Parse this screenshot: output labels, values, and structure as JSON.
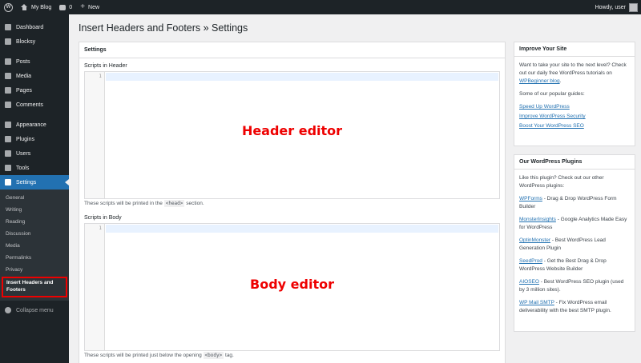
{
  "admin_bar": {
    "site_name": "My Blog",
    "comments_count": "0",
    "new_label": "New",
    "greeting": "Howdy, user"
  },
  "sidebar": {
    "top_items": [
      {
        "label": "Dashboard",
        "icon": "dashboard-icon"
      },
      {
        "label": "Blocksy",
        "icon": "blocksy-icon"
      }
    ],
    "content_items": [
      {
        "label": "Posts",
        "icon": "pin-icon"
      },
      {
        "label": "Media",
        "icon": "media-icon"
      },
      {
        "label": "Pages",
        "icon": "page-icon"
      },
      {
        "label": "Comments",
        "icon": "comment-icon"
      }
    ],
    "admin_items": [
      {
        "label": "Appearance",
        "icon": "brush-icon"
      },
      {
        "label": "Plugins",
        "icon": "plug-icon"
      },
      {
        "label": "Users",
        "icon": "user-icon"
      },
      {
        "label": "Tools",
        "icon": "wrench-icon"
      },
      {
        "label": "Settings",
        "icon": "settings-icon"
      }
    ],
    "submenu": [
      "General",
      "Writing",
      "Reading",
      "Discussion",
      "Media",
      "Permalinks",
      "Privacy"
    ],
    "current_submenu": "Insert Headers and Footers",
    "collapse_label": "Collapse menu"
  },
  "main": {
    "page_title": "Insert Headers and Footers » Settings",
    "box_title": "Settings",
    "header_label": "Scripts in Header",
    "header_line": "1",
    "header_overlay": "Header editor",
    "header_hint_pre": "These scripts will be printed in the",
    "header_hint_code": "<head>",
    "header_hint_post": "section.",
    "body_label": "Scripts in Body",
    "body_line": "1",
    "body_overlay": "Body editor",
    "body_hint_pre": "These scripts will be printed just below the opening",
    "body_hint_code": "<body>",
    "body_hint_post": "tag."
  },
  "improve_widget": {
    "title": "Improve Your Site",
    "intro_pre": "Want to take your site to the next level? Check out our daily free WordPress tutorials on",
    "intro_link": "WPBeginner blog",
    "intro_post": ".",
    "guides_intro": "Some of our popular guides:",
    "links": [
      "Speed Up WordPress",
      "Improve WordPress Security",
      "Boost Your WordPress SEO"
    ]
  },
  "plugins_widget": {
    "title": "Our WordPress Plugins",
    "intro": "Like this plugin? Check out our other WordPress plugins:",
    "plugins": [
      {
        "name": "WPForms",
        "desc": " - Drag & Drop WordPress Form Builder"
      },
      {
        "name": "MonsterInsights",
        "desc": " - Google Analytics Made Easy for WordPress"
      },
      {
        "name": "OptinMonster",
        "desc": " - Best WordPress Lead Generation Plugin"
      },
      {
        "name": "SeedProd",
        "desc": " - Get the Best Drag & Drop WordPress Website Builder"
      },
      {
        "name": "AIOSEO",
        "desc": " - Best WordPress SEO plugin (used by 3 million sites)."
      },
      {
        "name": "WP Mail SMTP",
        "desc": " - Fix WordPress email deliverability with the best SMTP plugin."
      }
    ]
  },
  "colors": {
    "accent": "#2271b1",
    "highlight": "#ee0000",
    "admin_dark": "#1d2327"
  }
}
